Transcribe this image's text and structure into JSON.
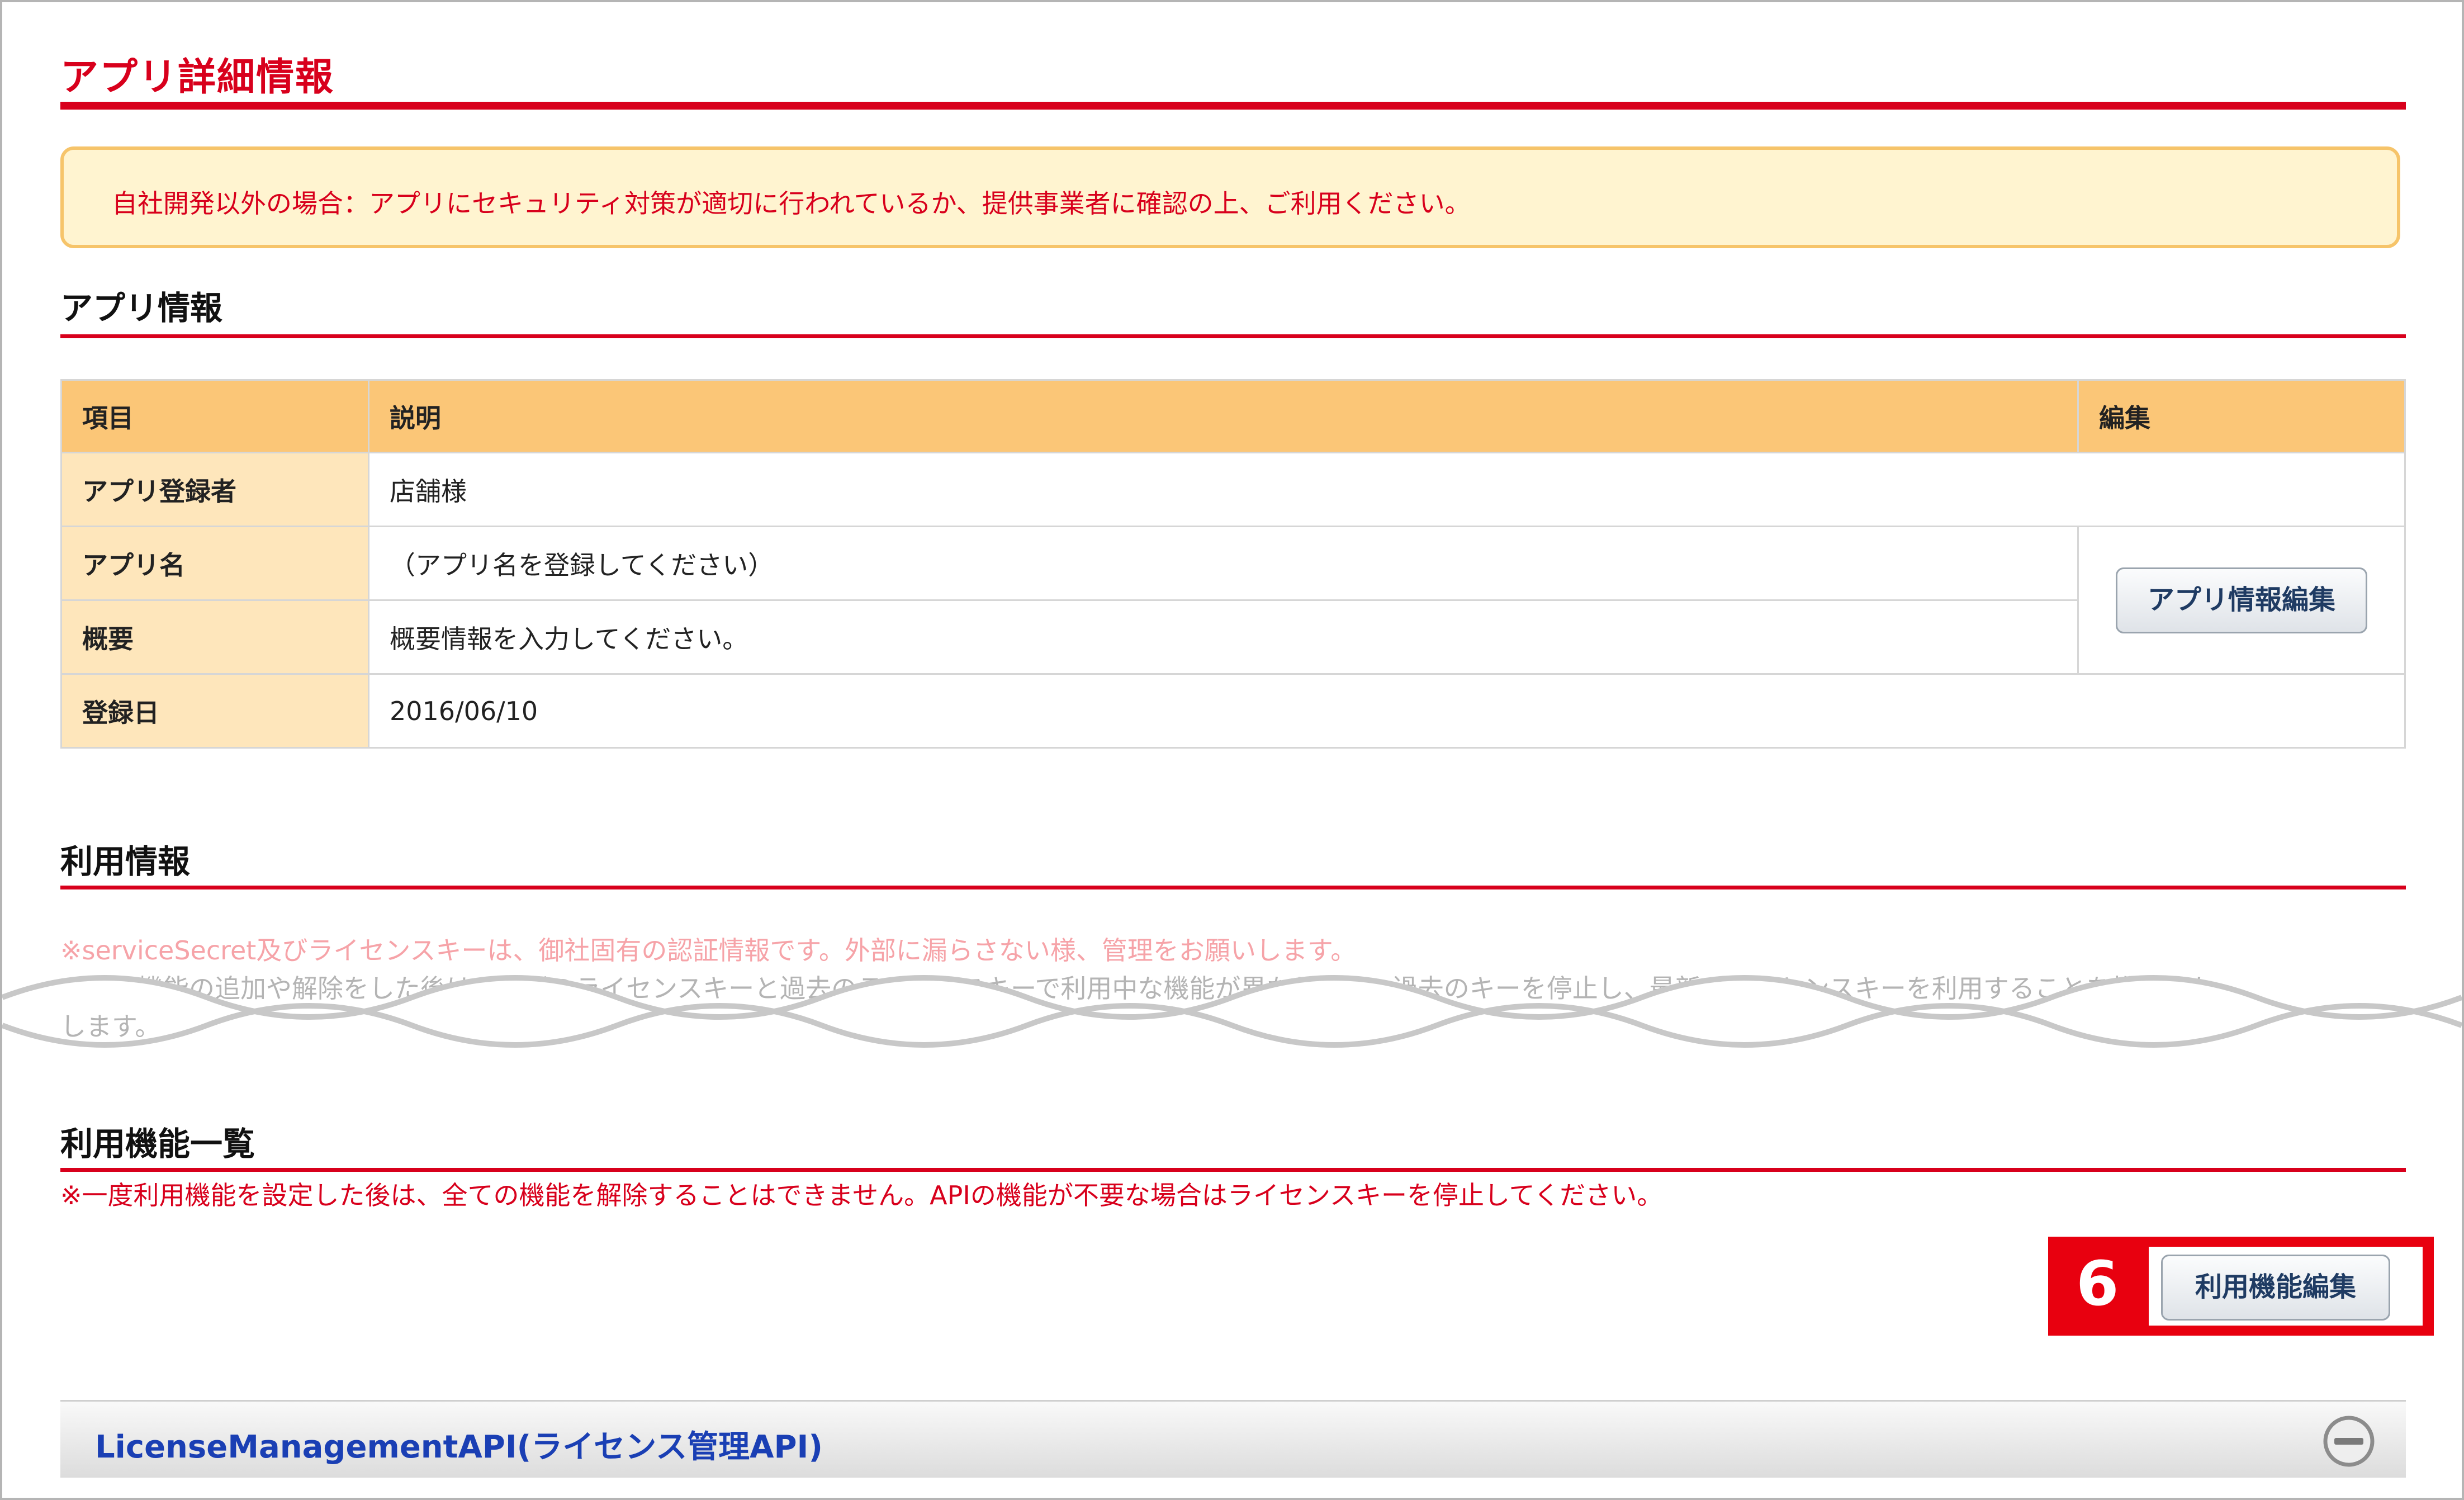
{
  "page": {
    "title": "アプリ詳細情報",
    "notice": "自社開発以外の場合：アプリにセキュリティ対策が適切に行われているか、提供事業者に確認の上、ご利用ください。"
  },
  "app_info": {
    "heading": "アプリ情報",
    "table": {
      "headers": [
        "項目",
        "説明",
        "編集"
      ],
      "rows": [
        {
          "label": "アプリ登録者",
          "value": "店舗様"
        },
        {
          "label": "アプリ名",
          "value": "（アプリ名を登録してください）"
        },
        {
          "label": "概要",
          "value": "概要情報を入力してください。"
        },
        {
          "label": "登録日",
          "value": "2016/06/10"
        }
      ],
      "edit_button": "アプリ情報編集"
    }
  },
  "usage_info": {
    "heading": "利用情報",
    "note_1": "※serviceSecret及びライセンスキーは、御社固有の認証情報です。外部に漏らさない様、管理をお願いします。",
    "note_2": "・利用機能の追加や解除をした後は、最新のライセンスキーと過去のライセンスキーで利用中な機能が異なります。過去のキーを停止し、最新のライセンスキーを利用することを推奨いた",
    "note_3": "します。"
  },
  "features": {
    "heading": "利用機能一覧",
    "warning": "※一度利用機能を設定した後は、全ての機能を解除することはできません。APIの機能が不要な場合はライセンスキーを停止してください。",
    "step_number": "6",
    "edit_button": "利用機能編集",
    "accordion_title": "LicenseManagementAPI(ライセンス管理API)"
  },
  "colors": {
    "accent_red": "#d8001c",
    "table_header": "#fbc677",
    "table_label": "#fee6bb",
    "notice_bg": "#fff4d0",
    "highlight": "#e8000f",
    "link_blue": "#1a3fb4"
  }
}
